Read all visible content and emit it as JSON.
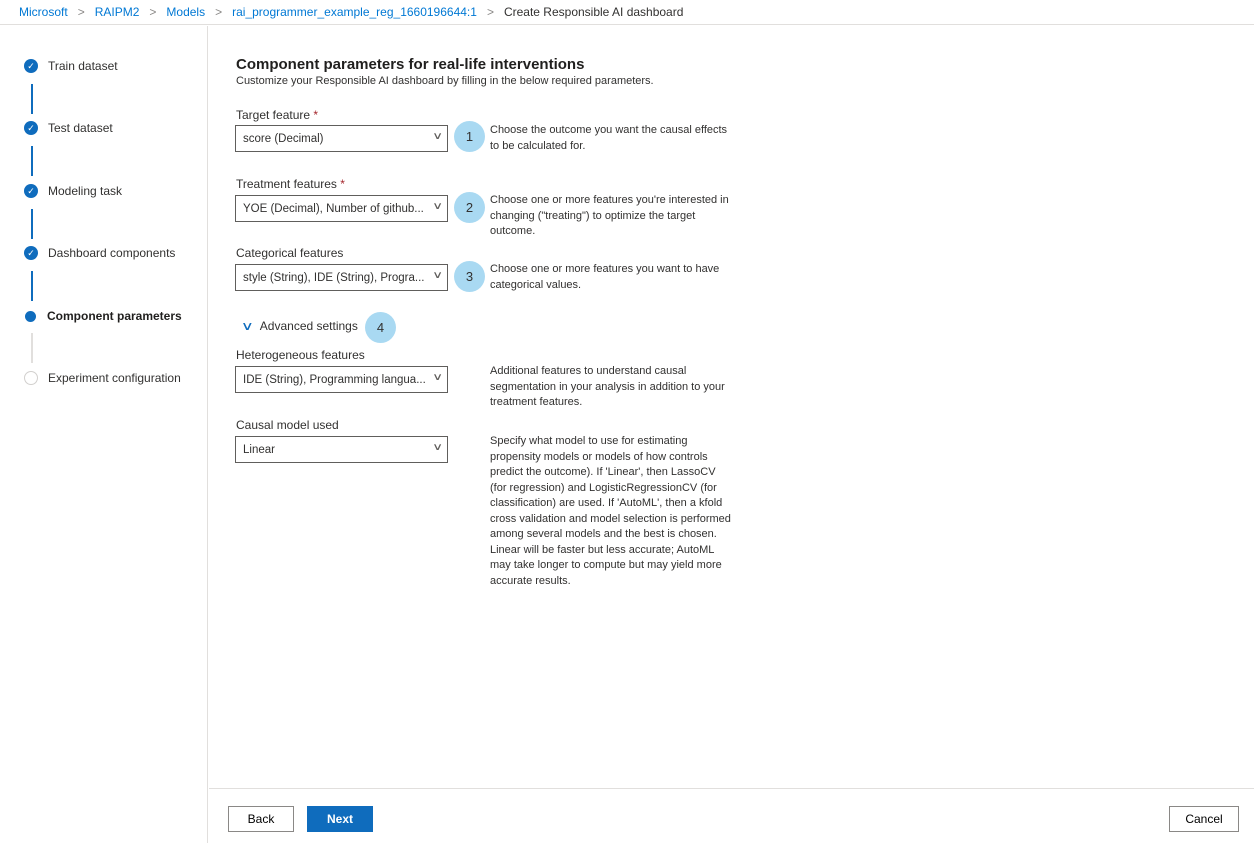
{
  "breadcrumb": [
    "Microsoft",
    "RAIPM2",
    "Models",
    "rai_programmer_example_reg_1660196644:1",
    "Create Responsible AI dashboard"
  ],
  "steps": [
    {
      "label": "Train dataset",
      "status": "done"
    },
    {
      "label": "Test dataset",
      "status": "done"
    },
    {
      "label": "Modeling task",
      "status": "done"
    },
    {
      "label": "Dashboard components",
      "status": "done"
    },
    {
      "label": "Component parameters",
      "status": "current"
    },
    {
      "label": "Experiment configuration",
      "status": "todo"
    }
  ],
  "page": {
    "title": "Component parameters for real-life interventions",
    "subtitle": "Customize your Responsible AI dashboard by filling in the below required parameters."
  },
  "fields": {
    "target": {
      "label": "Target feature",
      "value": "score (Decimal)",
      "badge": "1",
      "help": "Choose the outcome you want the causal effects to be calculated for."
    },
    "treatment": {
      "label": "Treatment features",
      "value": "YOE (Decimal), Number of github...",
      "badge": "2",
      "help": "Choose one or more features you're interested in changing (\"treating\") to optimize the target outcome."
    },
    "categorical": {
      "label": "Categorical features",
      "value": "style (String), IDE (String), Progra...",
      "badge": "3",
      "help": "Choose one or more features you want to have categorical values."
    },
    "advanced": {
      "label": "Advanced settings",
      "badge": "4"
    },
    "heterogeneous": {
      "label": "Heterogeneous features",
      "value": "IDE (String), Programming langua...",
      "help": "Additional features to understand causal segmentation in your analysis in addition to your treatment features."
    },
    "model": {
      "label": "Causal model used",
      "value": "Linear",
      "help": "Specify what model to use for estimating propensity models or models of how controls predict the outcome). If 'Linear', then LassoCV (for regression) and LogisticRegressionCV (for classification) are used. If 'AutoML', then a kfold cross validation and model selection is performed among several models and the best is chosen. Linear will be faster but less accurate; AutoML may take longer to compute but may yield more accurate results."
    }
  },
  "required_mark": "*",
  "footer": {
    "back": "Back",
    "next": "Next",
    "cancel": "Cancel"
  }
}
